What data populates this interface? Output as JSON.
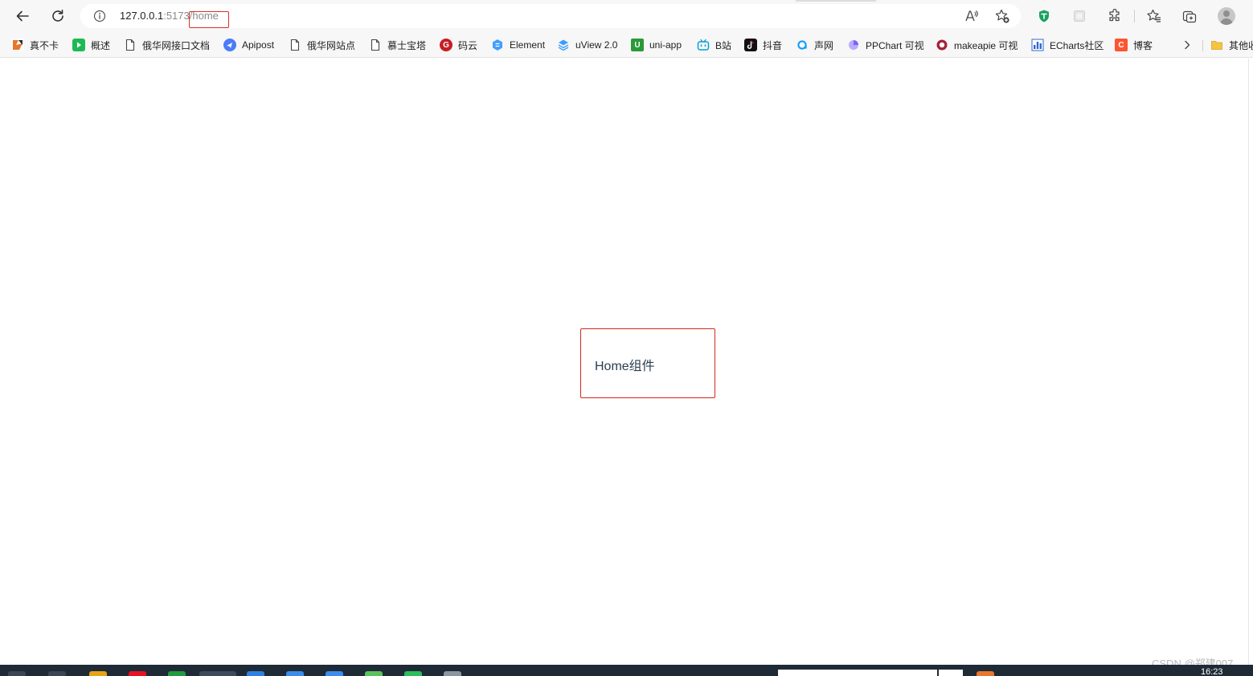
{
  "browser": {
    "url": {
      "host": "127.0.0.1",
      "port": ":5173",
      "path": "/home"
    },
    "toolbar_icons": [
      "back-icon",
      "refresh-icon",
      "info-icon",
      "read-aloud-icon",
      "add-favorite-icon",
      "shield-extension-icon",
      "extension-icon",
      "puzzle-icon",
      "favorites-icon",
      "collections-icon",
      "profile-avatar"
    ],
    "bookmarks": [
      {
        "label": "真不卡",
        "icon": "s-logo-icon",
        "color": "#e8762d"
      },
      {
        "label": "概述",
        "icon": "play-icon",
        "color": "#1db954"
      },
      {
        "label": "俄华网接口文档",
        "icon": "page-icon",
        "color": "#5f6368"
      },
      {
        "label": "Apipost",
        "icon": "apipost-icon",
        "color": "#4a7cf7"
      },
      {
        "label": "俄华网站点",
        "icon": "page-icon",
        "color": "#5f6368"
      },
      {
        "label": "慕士宝塔",
        "icon": "page-icon",
        "color": "#5f6368"
      },
      {
        "label": "码云",
        "icon": "gitee-icon",
        "color": "#c71d23"
      },
      {
        "label": "Element",
        "icon": "element-icon",
        "color": "#409eff"
      },
      {
        "label": "uView 2.0",
        "icon": "uview-icon",
        "color": "#3c9cff"
      },
      {
        "label": "uni-app",
        "icon": "uniapp-icon",
        "color": "#2b9939"
      },
      {
        "label": "B站",
        "icon": "bilibili-icon",
        "color": "#00a1d6"
      },
      {
        "label": "抖音",
        "icon": "douyin-icon",
        "color": "#111111"
      },
      {
        "label": "声网",
        "icon": "agora-icon",
        "color": "#099dfd"
      },
      {
        "label": "PPChart 可视",
        "icon": "ppchart-icon",
        "color": "#7b61ff"
      },
      {
        "label": "makeapie 可视",
        "icon": "makeapie-icon",
        "color": "#a4213a"
      },
      {
        "label": "ECharts社区",
        "icon": "echarts-icon",
        "color": "#2f6ad0"
      },
      {
        "label": "博客",
        "icon": "csdn-icon",
        "color": "#fc5531"
      },
      {
        "label": "其他收",
        "icon": "folder-icon",
        "color": "#e8b339"
      }
    ]
  },
  "page": {
    "home_label": "Home组件"
  },
  "taskbar": {
    "clock": "16:23"
  },
  "watermark": "CSDN @郑建007"
}
